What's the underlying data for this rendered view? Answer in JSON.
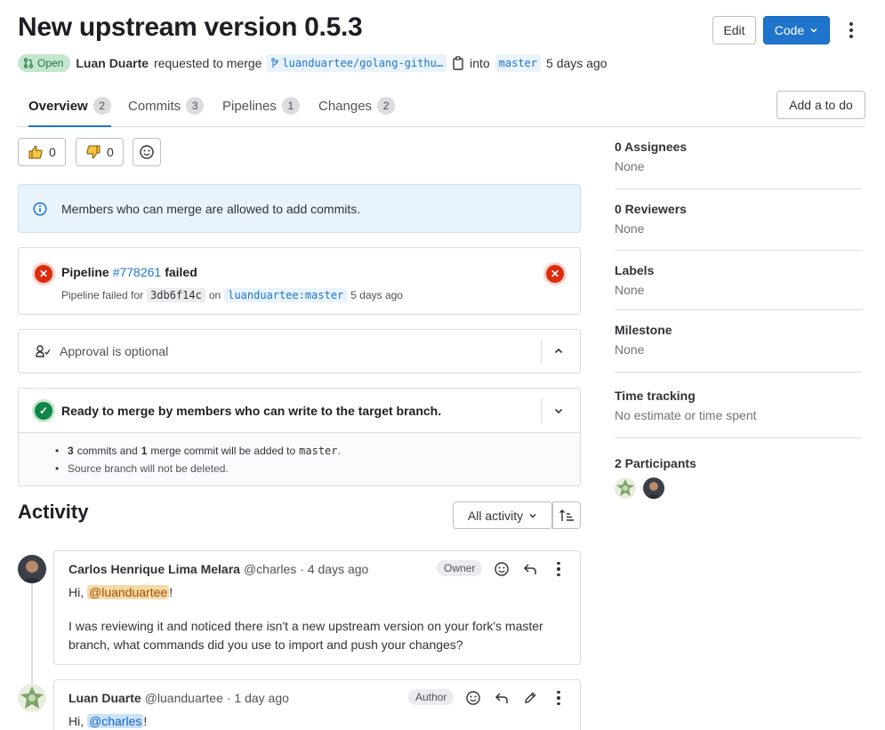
{
  "header": {
    "title": "New upstream version 0.5.3",
    "edit_label": "Edit",
    "code_label": "Code",
    "status": "Open",
    "author": "Luan Duarte",
    "requested_text": "requested to merge",
    "source_branch": "luanduartee/golang-githu…",
    "into_text": "into",
    "target_branch": "master",
    "time": "5 days ago"
  },
  "tabs": [
    {
      "label": "Overview",
      "count": "2"
    },
    {
      "label": "Commits",
      "count": "3"
    },
    {
      "label": "Pipelines",
      "count": "1"
    },
    {
      "label": "Changes",
      "count": "2"
    }
  ],
  "todo_label": "Add a to do",
  "reactions": {
    "thumbs_up": "0",
    "thumbs_down": "0"
  },
  "info_banner": "Members who can merge are allowed to add commits.",
  "pipeline": {
    "prefix": "Pipeline",
    "id": "#778261",
    "status": "failed",
    "detail_prefix": "Pipeline failed for",
    "commit": "3db6f14c",
    "on": "on",
    "branch": "luanduartee:master",
    "time": "5 days ago"
  },
  "approval": "Approval is optional",
  "merge": {
    "title": "Ready to merge by members who can write to the target branch.",
    "commits_count": "3",
    "commits_text": "commits and",
    "merge_count": "1",
    "merge_text": "merge commit will be added to",
    "target": "master",
    "period": ".",
    "source_note": "Source branch will not be deleted."
  },
  "sidebar": [
    {
      "label": "0 Assignees",
      "value": "None"
    },
    {
      "label": "0 Reviewers",
      "value": "None"
    },
    {
      "label": "Labels",
      "value": "None"
    },
    {
      "label": "Milestone",
      "value": "None"
    },
    {
      "label": "Time tracking",
      "value": "No estimate or time spent"
    },
    {
      "label": "2 Participants",
      "value": ""
    }
  ],
  "activity": {
    "title": "Activity",
    "filter": "All activity"
  },
  "notes": [
    {
      "author": "Carlos Henrique Lima Melara",
      "handle": "@charles",
      "time": "· 4 days ago",
      "role": "Owner",
      "greeting": "Hi,",
      "mention": "@luanduartee",
      "excl": "!",
      "body": "I was reviewing it and noticed there isn't a new upstream version on your fork's master branch, what commands did you use to import and push your changes?"
    },
    {
      "author": "Luan Duarte",
      "handle": "@luanduartee",
      "time": "· 1 day ago",
      "role": "Author",
      "greeting": "Hi,",
      "mention": "@charles",
      "excl": "!"
    }
  ],
  "colors": {
    "primary": "#1f75cb",
    "danger": "#dd2b0e",
    "success": "#108548",
    "info_bg": "#e9f3fc"
  }
}
